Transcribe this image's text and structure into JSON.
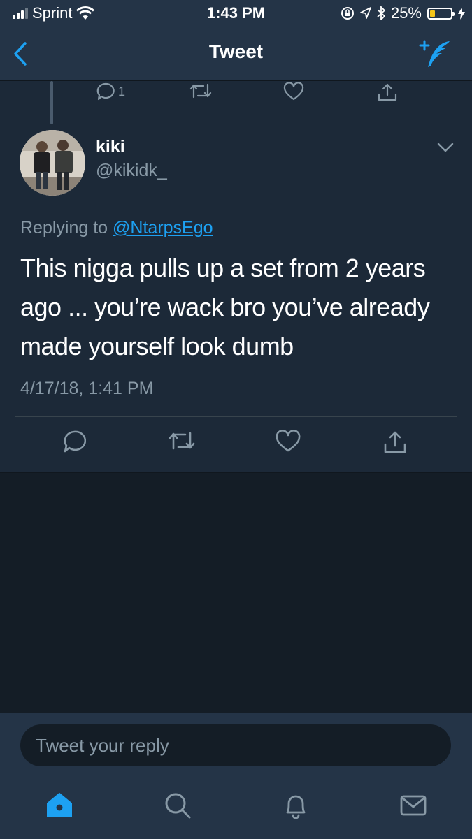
{
  "status_bar": {
    "carrier": "Sprint",
    "time": "1:43 PM",
    "battery_percent": "25%",
    "battery_level": 0.25,
    "signal_bars_on": 3,
    "signal_bars_total": 4
  },
  "nav": {
    "title": "Tweet",
    "back_icon": "chevron-left-icon",
    "compose_icon": "compose-tweet-icon"
  },
  "previous_tweet": {
    "reply_count": "1"
  },
  "tweet": {
    "name": "kiki",
    "handle": "@kikidk_",
    "replying_prefix": "Replying to",
    "replying_to": "@NtarpsEgo",
    "text": "This nigga pulls up a set from 2 years ago ... you’re wack bro you’ve already made yourself look dumb",
    "timestamp": "4/17/18, 1:41 PM"
  },
  "reply_bar": {
    "placeholder": "Tweet your reply"
  },
  "tabs": [
    "home-icon",
    "search-icon",
    "notifications-icon",
    "messages-icon"
  ],
  "colors": {
    "accent": "#1da1f2",
    "background": "#141d26",
    "tweet_bg": "#1c2938",
    "bar_bg": "#243447",
    "secondary_text": "#8899a6",
    "battery": "#f5c518"
  }
}
